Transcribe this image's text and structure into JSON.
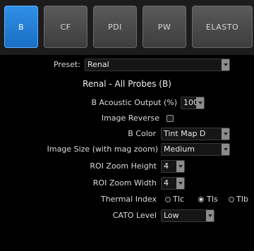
{
  "tabs": [
    {
      "label": "B",
      "active": true
    },
    {
      "label": "CF",
      "active": false
    },
    {
      "label": "PDI",
      "active": false
    },
    {
      "label": "PW",
      "active": false
    },
    {
      "label": "ELASTO",
      "active": false
    }
  ],
  "preset": {
    "label": "Preset:",
    "value": "Renal"
  },
  "section_title": "Renal - All Probes (B)",
  "settings": {
    "acoustic_output": {
      "label": "B Acoustic Output (%)",
      "value": "100"
    },
    "image_reverse": {
      "label": "Image Reverse",
      "checked": false
    },
    "b_color": {
      "label": "B Color",
      "value": "Tint Map D"
    },
    "image_size": {
      "label": "Image Size (with mag zoom)",
      "value": "Medium"
    },
    "roi_zoom_height": {
      "label": "ROI Zoom Height",
      "value": "4"
    },
    "roi_zoom_width": {
      "label": "ROI Zoom Width",
      "value": "4"
    },
    "thermal_index": {
      "label": "Thermal Index",
      "options": [
        "TIc",
        "TIs",
        "TIb"
      ],
      "selected": "TIs"
    },
    "cato_level": {
      "label": "CATO Level",
      "value": "Low"
    }
  },
  "colors": {
    "accent": "#1a6fc4",
    "background": "#000000"
  }
}
